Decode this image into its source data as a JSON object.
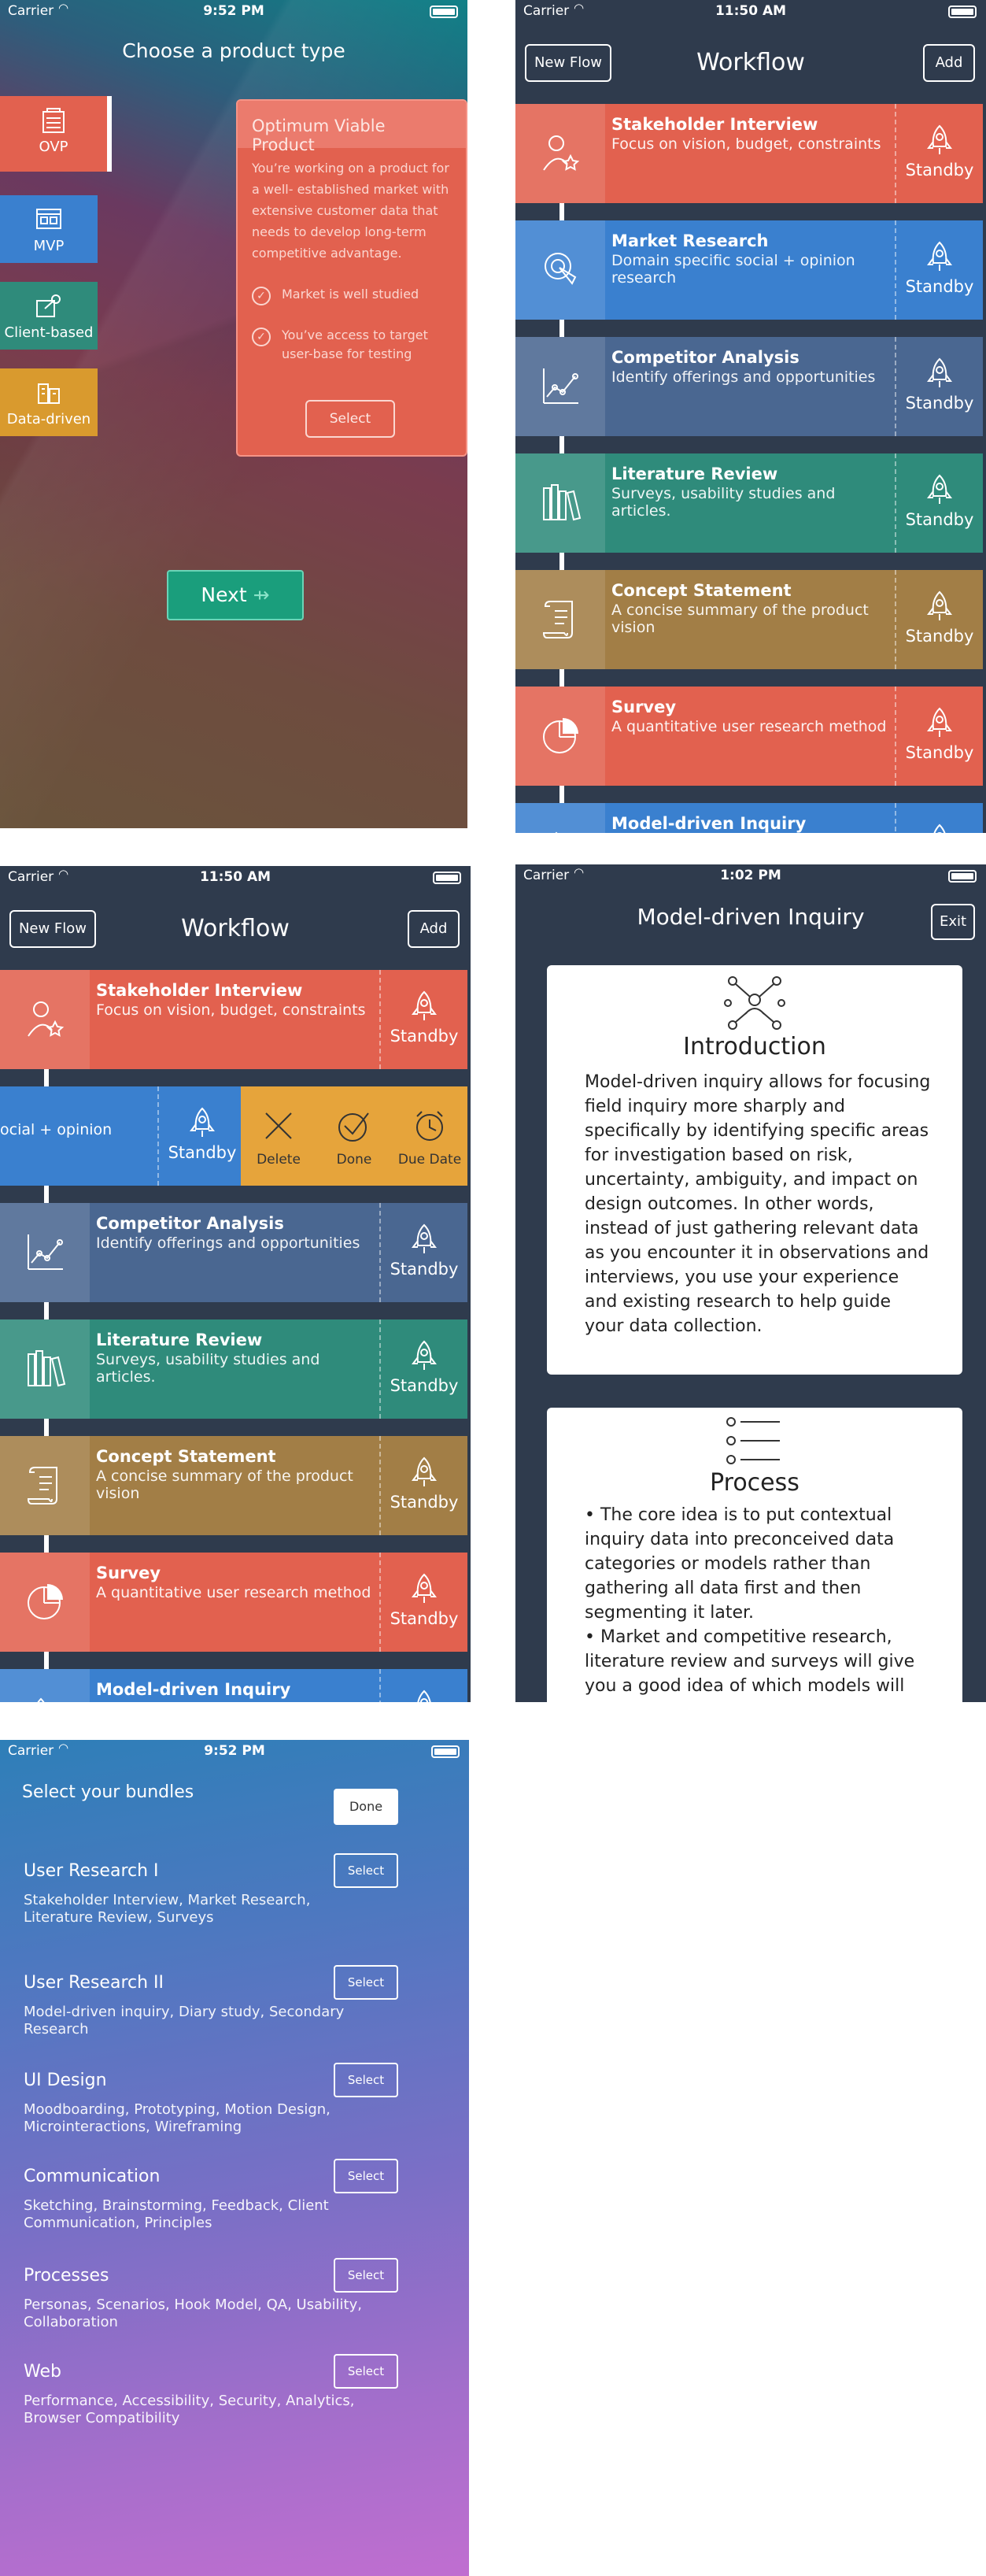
{
  "status": {
    "carrier": "Carrier",
    "time_1": "9:52 PM",
    "time_2": "11:50 AM",
    "time_3": "11:50 AM",
    "time_4": "1:02 PM",
    "time_5": "9:52 PM"
  },
  "product_type": {
    "title": "Choose a product type",
    "tiles": [
      {
        "label": "OVP",
        "color": "#e2614f"
      },
      {
        "label": "MVP",
        "color": "#3a80cf"
      },
      {
        "label": "Client-based",
        "color": "#2f8b7b"
      },
      {
        "label": "Data-driven",
        "color": "#d99a2e"
      }
    ],
    "card": {
      "title": "Optimum Viable Product",
      "description": "You’re working on a product for a well- established market with extensive customer data that needs to develop long-term competitive advantage.",
      "checks": [
        "Market is well studied",
        "You’ve access to target user-base for testing"
      ],
      "select_label": "Select"
    },
    "next_label": "Next"
  },
  "workflow": {
    "title": "Workflow",
    "new_flow_label": "New Flow",
    "add_label": "Add",
    "standby_label": "Standby",
    "items": [
      {
        "title": "Stakeholder Interview",
        "subtitle": "Focus on vision, budget, constraints",
        "color": "#e2614f",
        "icon": "stakeholder-icon"
      },
      {
        "title": "Market Research",
        "subtitle": "Domain specific social + opinion research",
        "color": "#3a80cf",
        "icon": "market-research-icon"
      },
      {
        "title": "Competitor Analysis",
        "subtitle": "Identify offerings and opportunities",
        "color": "#4a6791",
        "icon": "chart-icon"
      },
      {
        "title": "Literature Review",
        "subtitle": "Surveys, usability studies and articles.",
        "color": "#2f8b7b",
        "icon": "books-icon"
      },
      {
        "title": "Concept Statement",
        "subtitle": "A concise summary of the product vision",
        "color": "#a27e46",
        "icon": "scroll-icon"
      },
      {
        "title": "Survey",
        "subtitle": "A quantitative user research method",
        "color": "#e2614f",
        "icon": "pie-icon"
      },
      {
        "title": "Model-driven Inquiry",
        "subtitle": "",
        "color": "#3a80cf",
        "icon": "rocket-icon"
      }
    ],
    "swipe_visible_text": "ocial + opinion",
    "swipe_actions": [
      {
        "label": "Delete",
        "icon": "x-icon"
      },
      {
        "label": "Done",
        "icon": "check-icon"
      },
      {
        "label": "Due Date",
        "icon": "clock-icon"
      }
    ]
  },
  "inquiry": {
    "title": "Model-driven Inquiry",
    "exit_label": "Exit",
    "intro_heading": "Introduction",
    "intro_text": "Model-driven inquiry allows for focusing field inquiry more sharply and specifically by identifying specific areas for investigation based on risk, uncertainty, ambiguity, and impact on design outcomes. In other words, instead of just gathering relevant data as you encounter it in observations and interviews, you use your experience and existing research to help guide your data collection.",
    "process_heading": "Process",
    "process_bullets": [
      "• The core idea is to put contextual inquiry data into preconceived data categories or models rather than gathering all data first and then segmenting it later.",
      "• Market and competitive research, literature review and surveys will give you a good idea of which models will"
    ]
  },
  "bundles": {
    "title": "Select your bundles",
    "done_label": "Done",
    "select_label": "Select",
    "items": [
      {
        "name": "User Research I",
        "items": "Stakeholder Interview, Market Research, Literature Review, Surveys"
      },
      {
        "name": "User Research II",
        "items": "Model-driven inquiry, Diary study, Secondary Research"
      },
      {
        "name": "UI Design",
        "items": "Moodboarding, Prototyping, Motion Design, Microinteractions, Wireframing"
      },
      {
        "name": "Communication",
        "items": "Sketching, Brainstorming, Feedback, Client Communication, Principles"
      },
      {
        "name": "Processes",
        "items": "Personas, Scenarios, Hook Model, QA, Usability, Collaboration"
      },
      {
        "name": "Web",
        "items": "Performance, Accessibility, Security, Analytics, Browser Compatibility"
      }
    ]
  }
}
